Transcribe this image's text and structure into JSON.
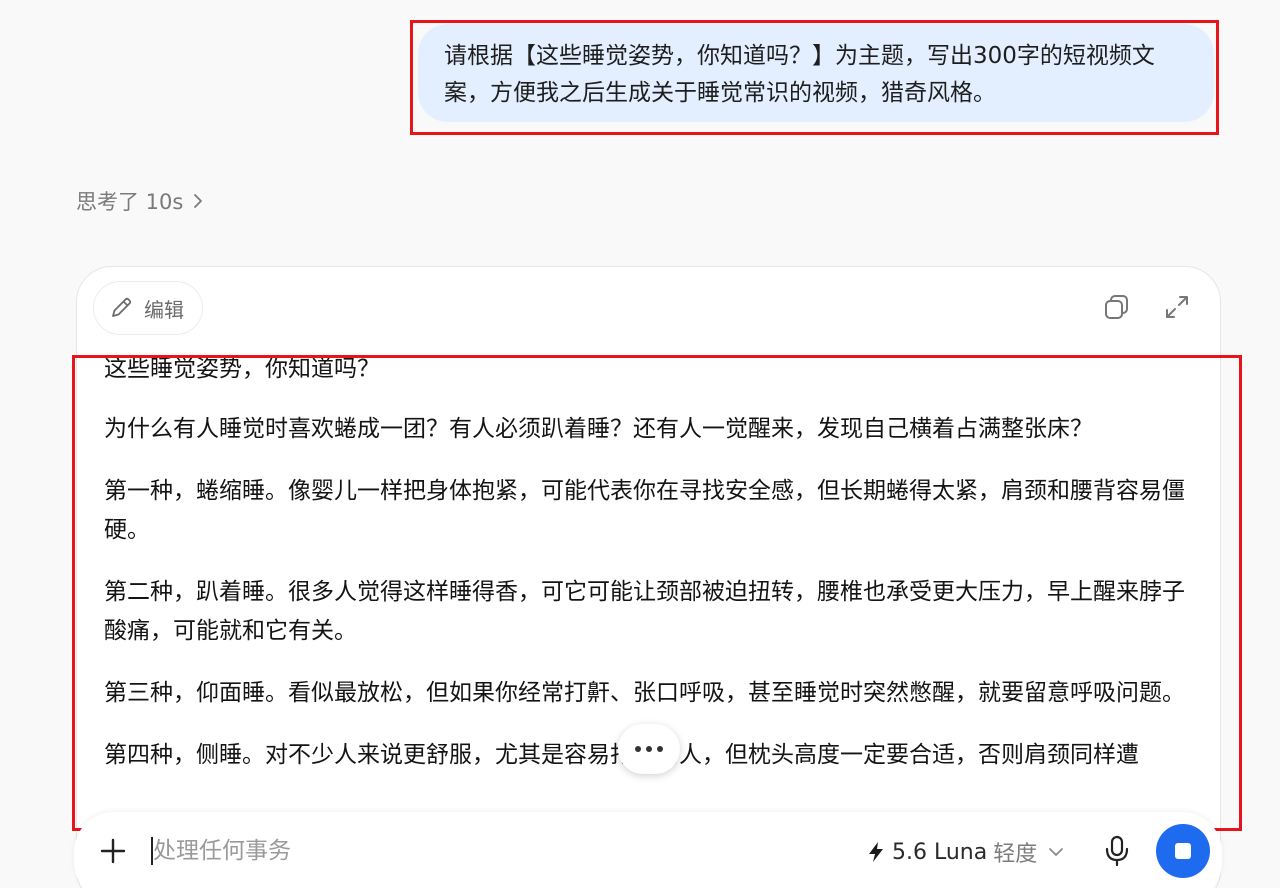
{
  "user_message": {
    "line1": "请根据【这些睡觉姿势，你知道吗？】为主题，写出300字的短视频文",
    "line2": "案，方便我之后生成关于睡觉常识的视频，猎奇风格。"
  },
  "thinking": {
    "label": "思考了 10s"
  },
  "canvas": {
    "edit_label": "编辑",
    "paragraphs": [
      "这些睡觉姿势，你知道吗？",
      "为什么有人睡觉时喜欢蜷成一团？有人必须趴着睡？还有人一觉醒来，发现自己横着占满整张床？",
      "第一种，蜷缩睡。像婴儿一样把身体抱紧，可能代表你在寻找安全感，但长期蜷得太紧，肩颈和腰背容易僵硬。",
      "第二种，趴着睡。很多人觉得这样睡得香，可它可能让颈部被迫扭转，腰椎也承受更大压力，早上醒来脖子酸痛，可能就和它有关。",
      "第三种，仰面睡。看似最放松，但如果你经常打鼾、张口呼吸，甚至睡觉时突然憋醒，就要留意呼吸问题。",
      "第四种，侧睡。对不少人来说更舒服，尤其是容易打鼾的人，但枕头高度一定要合适，否则肩颈同样遭"
    ]
  },
  "composer": {
    "placeholder": "处理任何事务",
    "model_version": "5.6 Luna",
    "model_mode": "轻度"
  },
  "colors": {
    "user_bubble": "#e3efff",
    "annotation_red": "#e8141b",
    "stop_button": "#1e6bf0"
  }
}
